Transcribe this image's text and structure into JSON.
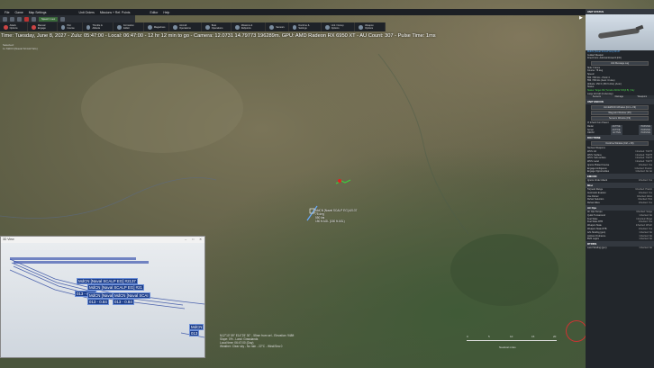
{
  "menu": [
    "File",
    "Game",
    "Map Settings",
    "",
    "Unit Orders",
    "Missions + Ref. Points",
    "",
    "Editor",
    "Help"
  ],
  "toolbar": {
    "time_compression": "Speed: 1 sec",
    "speed_label": "Speed: 1 sec"
  },
  "commands": [
    {
      "label": "Attack Options",
      "icon": "red"
    },
    {
      "label": "Manual Engage",
      "icon": "red"
    },
    {
      "label": "Plot Course",
      "icon": "blue"
    },
    {
      "label": "Throttle & Altitude",
      "icon": "blue"
    },
    {
      "label": "Formation Editor",
      "icon": "blue"
    },
    {
      "label": "Magazines",
      "icon": "blue"
    },
    {
      "label": "Aircraft Operations",
      "icon": "blue"
    },
    {
      "label": "Boat Operations",
      "icon": "blue"
    },
    {
      "label": "Missions & Refpoints",
      "icon": "blue"
    },
    {
      "label": "Sensors",
      "icon": "blue"
    },
    {
      "label": "Doctrine & Settings",
      "icon": "blue"
    },
    {
      "label": "Unit / Group Options",
      "icon": "blue"
    },
    {
      "label": "Weapon Options",
      "icon": "blue"
    }
  ],
  "status_line": "Time: Tuesday, June 8, 2027 - Zulu: 05:47:00 - Local: 06:47:00 - 12 hr 12 min to go  -  Camera: 12.0731 14.79773 196289m. GPU: AMD Radeon RX 6950 XT - AU Count: 307 - Pulse Time: 1ms",
  "selected": {
    "line1": "Selected:",
    "line2": "1x MdCN [Naval SCALP EG]"
  },
  "unit_label": {
    "line1": "MdCN [Naval SCALP EG] #2137",
    "line2": "78 deg",
    "line3": "550 kts",
    "line4": "150 ft AGL (150 ft ASL)"
  },
  "map_info": {
    "line1": "N12°10' 59\" E14°25' 30\" - 55nm from sel - Elevation: 948ft",
    "line2": "Slope: 0% - Land: Grasslands",
    "line3": "Local time: 06:47:00 (Day)",
    "line4": "Weather: Clear sky - No rain - 22°C - Wind/Sea 0"
  },
  "scale": {
    "ticks": [
      "0",
      "5",
      "10",
      "15",
      "20"
    ],
    "caption": "Nautical miles"
  },
  "win3d": {
    "title": "3D View",
    "labels": [
      "MdCN [Naval SCALP EG] #2137",
      "MdCN [Naval SCALP EG] #21",
      "013 - 0.84",
      "MdCN [Naval SCALP EG] #2",
      "013 - 0.84",
      "MdCN [Naval SCAI",
      "013 - 0.84",
      "MdCN",
      "013"
    ]
  },
  "panel": {
    "unit_status_hd": "UNIT STATUS",
    "unit_name": "MdCN [Naval SCALP EG] #2137",
    "unit_type": "Guided Weapon",
    "side_line": "Fired From: Admiral Ronarch [FD]",
    "msg_log": "Unit Message Log",
    "side": "Side: France",
    "course": "Course: 78 deg",
    "speed": "Speed:",
    "speed_vals": "550 / 550 kts - Plotd: 0",
    "speed_sub": "550 / 550 kts (Auto: Cruise)",
    "altitude": "Altitude: 150 ft (150 ft AGL) (Auto)",
    "status_hd": "Status:",
    "status_val": "Status: Target 99 (Tumobu 60/22 N'Djfi B) | Sky",
    "status_sub": "Large Aircraft (Underway)",
    "tabs": [
      "Sensors",
      "Damage",
      "Weapons"
    ],
    "unit_orcon_hd": "UNIT EMCON",
    "emcon_btn": "Unit EMCON Window (Ctrl + F9)",
    "wp_btn": "Waypoint Window (F5)",
    "sensors_btn": "Sensors Window (F9)",
    "inherit_label": "Inherit from Parent",
    "emcon_rows": [
      {
        "name": "Radar",
        "a": "ACTIVE",
        "p": "PASSIVE"
      },
      {
        "name": "Sonar",
        "a": "ACTIVE",
        "p": "PASSIVE"
      },
      {
        "name": "OECM",
        "a": "ACTIVE",
        "p": "PASSIVE"
      }
    ],
    "doctrine_hd": "DOCTRINE",
    "doctrine_btn": "Doctrine Window (Ctrl + F9)",
    "nuclear": "Nuclear Weapons",
    "roe_rows": [
      {
        "k": "WCS: Air",
        "v": "Inherited: TIGHT"
      },
      {
        "k": "WCS: Surface",
        "v": "Inherited: TIGHT"
      },
      {
        "k": "WCS: Sub-surface",
        "v": "Inherited: TIGHT"
      },
      {
        "k": "WCS: Land",
        "v": "Inherited: TIGHT"
      },
      {
        "k": "Ignore Plotted Course",
        "v": "Inherited: Yes"
      },
      {
        "k": "Engage Ambiguous",
        "v": "Inherited: Pessim"
      },
      {
        "k": "Engage Opportunities",
        "v": "Inherited: No Jet"
      }
    ],
    "misc_hd": "EMCON",
    "misc_rows": [
      {
        "k": "Ignore Under Attack",
        "v": "Inherited: Yes"
      }
    ],
    "fuel_hd": "Misc",
    "fuel_rows": [
      {
        "k": "Torpedo Range",
        "v": "Inherited: Practic"
      },
      {
        "k": "Automatic Evasion",
        "v": "Inherited: Yes"
      },
      {
        "k": "Use Refuel",
        "v": "Inherited: Allow"
      },
      {
        "k": "Refuel Selection",
        "v": "Inherited: Pick"
      },
      {
        "k": "Refuel Allies",
        "v": "Inherited: Yes"
      }
    ],
    "ac_hd": "Air Ops",
    "ac_rows": [
      {
        "k": "Air Ops Tempo",
        "v": "Inherited: Surge"
      },
      {
        "k": "Quick Turnaround",
        "v": "Inherited: No"
      },
      {
        "k": "Fuel State",
        "v": "Inherited: Bingo"
      },
      {
        "k": "Fuel State RTB",
        "v": "Inherited: Yes"
      },
      {
        "k": "Weapon State",
        "v": "Inherited: Winch"
      },
      {
        "k": "Weapon State RTB",
        "v": "Inherited: Yes"
      },
      {
        "k": "A/G Strafing (gun)",
        "v": "Inherited: No"
      },
      {
        "k": "Jettison Ordnance",
        "v": "Inherited: No"
      },
      {
        "k": "BVR Logics",
        "v": "Inherited: No"
      }
    ],
    "rs_hd": "RTP/RS",
    "rs_rows": [
      {
        "k": "Land Strafing (gun)",
        "v": "Inherited: No"
      }
    ]
  },
  "colors": {
    "accent": "#5ab0ff",
    "panel_bg": "#22262b",
    "label_bg": "#1d3e8a"
  }
}
